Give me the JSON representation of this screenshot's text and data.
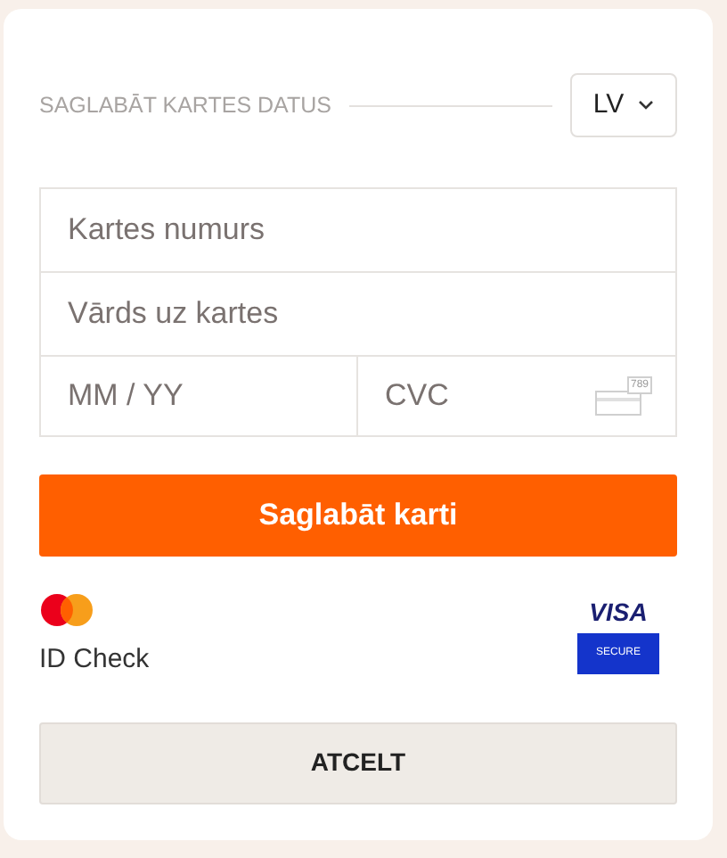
{
  "header": {
    "title": "SAGLABĀT KARTES DATUS",
    "language": "LV"
  },
  "fields": [
    {
      "placeholder": "Kartes numurs"
    },
    {
      "placeholder": "Vārds uz kartes"
    }
  ],
  "expiry": {
    "placeholder": "MM / YY"
  },
  "cvc": {
    "placeholder": "CVC",
    "icon_text": "789"
  },
  "save_button": "Saglabāt karti",
  "badges": {
    "mastercard_label": "ID Check",
    "visa_label": "VISA",
    "visa_secure": "SECURE"
  },
  "cancel_button": "ATCELT"
}
